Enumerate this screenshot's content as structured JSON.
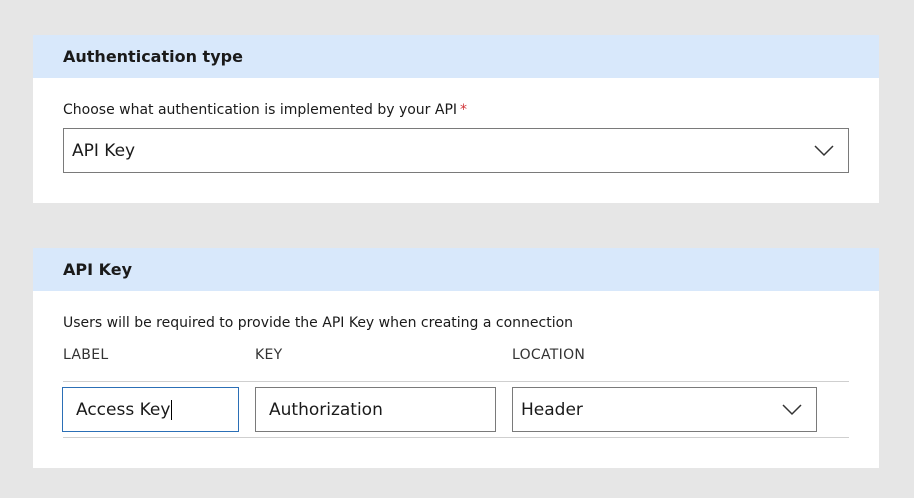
{
  "auth_section": {
    "title": "Authentication type",
    "description": "Choose what authentication is implemented by your API",
    "required_marker": "*",
    "select_value": "API Key"
  },
  "apikey_section": {
    "title": "API Key",
    "description": "Users will be required to provide the API Key when creating a connection",
    "columns": {
      "label": "LABEL",
      "key": "KEY",
      "location": "LOCATION"
    },
    "fields": {
      "label_value": "Access Key",
      "key_value": "Authorization",
      "location_value": "Header"
    }
  },
  "icons": {
    "dropdown": "chevron-down-icon"
  },
  "colors": {
    "header_bg": "#d8e8fb",
    "required": "#d13438",
    "focus_border": "#2b6fb6"
  }
}
